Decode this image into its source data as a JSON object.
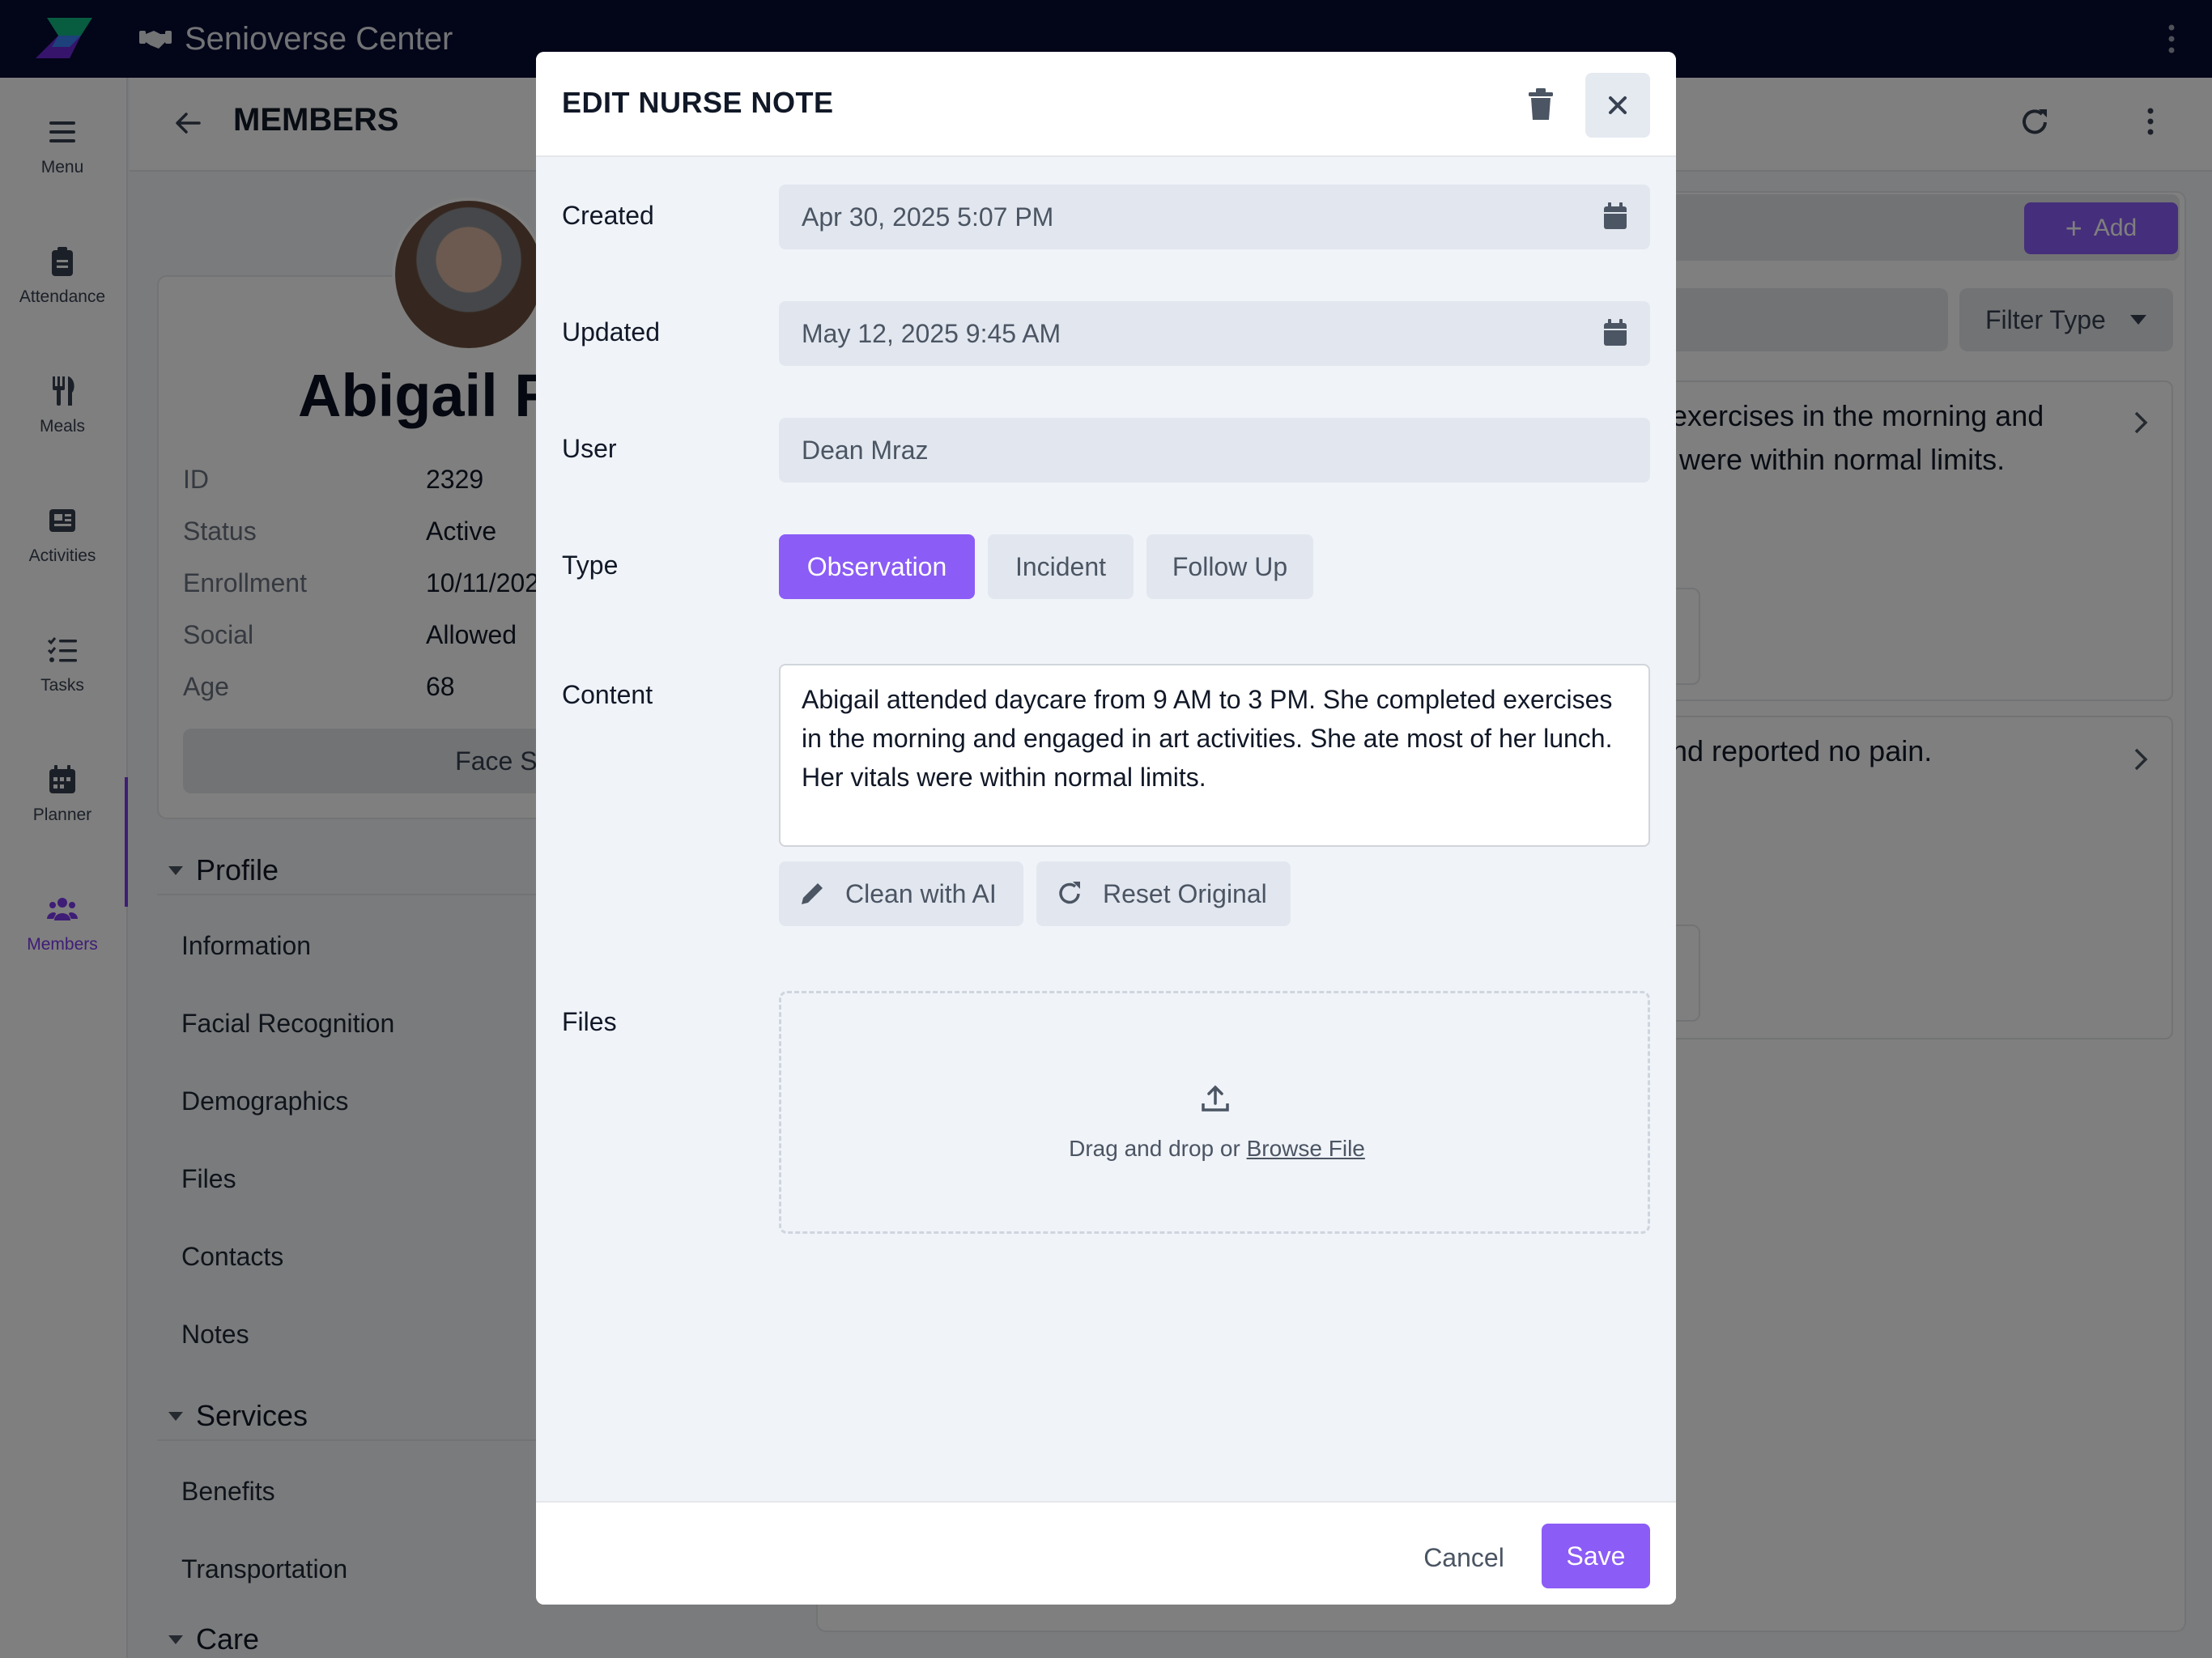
{
  "app": {
    "title": "Senioverse Center"
  },
  "sidebar": {
    "items": [
      {
        "label": "Menu",
        "icon": "hamburger-icon"
      },
      {
        "label": "Attendance",
        "icon": "clipboard-icon"
      },
      {
        "label": "Meals",
        "icon": "utensils-icon"
      },
      {
        "label": "Activities",
        "icon": "newspaper-icon"
      },
      {
        "label": "Tasks",
        "icon": "list-check-icon"
      },
      {
        "label": "Planner",
        "icon": "calendar-icon"
      },
      {
        "label": "Members",
        "icon": "users-icon",
        "active": true
      }
    ]
  },
  "page": {
    "title": "MEMBERS",
    "member": {
      "name": "Abigail R",
      "fields": [
        {
          "key": "ID",
          "value": "2329"
        },
        {
          "key": "Status",
          "value": "Active"
        },
        {
          "key": "Enrollment",
          "value": "10/11/202"
        },
        {
          "key": "Social",
          "value": "Allowed"
        },
        {
          "key": "Age",
          "value": "68"
        }
      ],
      "face_sheet": "Face Sheet"
    },
    "sections": [
      {
        "title": "Profile",
        "links": [
          "Information",
          "Facial Recognition",
          "Demographics",
          "Files",
          "Contacts",
          "Notes"
        ]
      },
      {
        "title": "Services",
        "links": [
          "Benefits",
          "Transportation"
        ]
      },
      {
        "title": "Care",
        "links": []
      }
    ],
    "right": {
      "add_label": "Add",
      "filter_type": "Filter Type",
      "notes": [
        {
          "line1": "exercises in the morning and",
          "line2": "were within normal limits."
        },
        {
          "line1": "nd reported no pain.",
          "line2": ""
        }
      ]
    }
  },
  "modal": {
    "title": "EDIT NURSE NOTE",
    "labels": {
      "created": "Created",
      "updated": "Updated",
      "user": "User",
      "type": "Type",
      "content": "Content",
      "files": "Files"
    },
    "created": "Apr 30, 2025 5:07 PM",
    "updated": "May 12, 2025 9:45 AM",
    "user": "Dean Mraz",
    "types": [
      "Observation",
      "Incident",
      "Follow Up"
    ],
    "selected_type": "Observation",
    "content": "Abigail attended daycare from 9 AM to 3 PM. She completed exercises in the morning and engaged in art activities. She ate most of her lunch. Her vitals were within normal limits.",
    "clean_ai": "Clean with AI",
    "reset_original": "Reset Original",
    "drop_text": "Drag and drop or",
    "browse": "Browse File",
    "cancel": "Cancel",
    "save": "Save"
  },
  "colors": {
    "topbar": "#060a33",
    "accent": "#8b5cf6"
  }
}
